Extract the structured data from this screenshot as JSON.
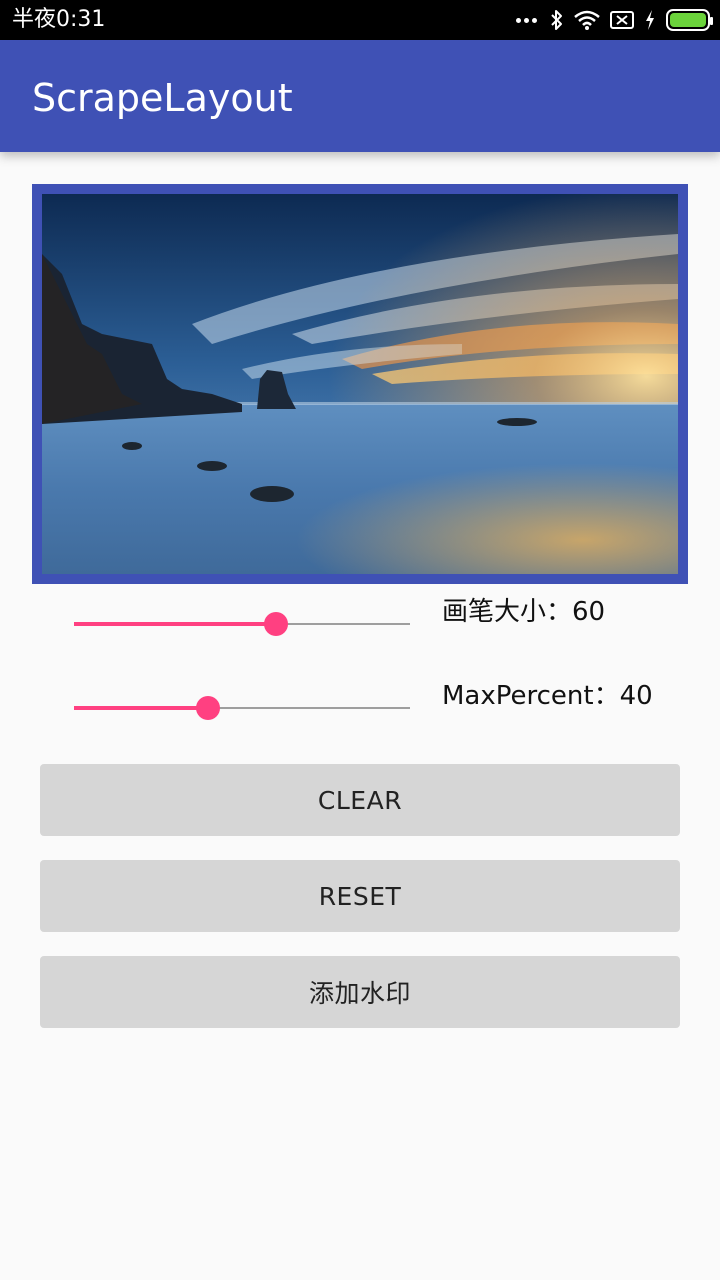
{
  "status_bar": {
    "time": "半夜0:31"
  },
  "app_bar": {
    "title": "ScrapeLayout"
  },
  "sliders": [
    {
      "label": "画笔大小：60",
      "value_percent": 60
    },
    {
      "label": "MaxPercent：40",
      "value_percent": 40
    }
  ],
  "buttons": {
    "clear": "CLEAR",
    "reset": "RESET",
    "watermark": "添加水印"
  },
  "colors": {
    "primary": "#3f51b5",
    "accent": "#ff4081",
    "button_bg": "#d6d6d6",
    "background": "#fafafa"
  }
}
